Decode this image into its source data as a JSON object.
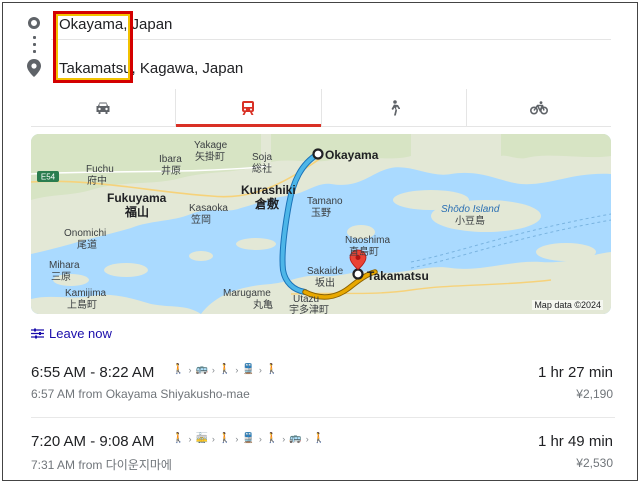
{
  "route": {
    "origin": "Okayama, Japan",
    "destination": "Takamatsu, Kagawa, Japan"
  },
  "modes": [
    {
      "name": "car-icon",
      "active": false
    },
    {
      "name": "train-icon",
      "active": true
    },
    {
      "name": "walk-icon",
      "active": false
    },
    {
      "name": "bike-icon",
      "active": false
    }
  ],
  "map": {
    "labels": {
      "okayama": "Okayama",
      "takamatsu": "Takamatsu",
      "kurashiki": "Kurashiki",
      "kurashiki_jp": "倉敷",
      "fukuyama": "Fukuyama",
      "fukuyama_jp": "福山",
      "yakage": "Yakage",
      "yakage_jp": "矢掛町",
      "soja": "Soja",
      "soja_jp": "総社",
      "ibara": "Ibara",
      "ibara_jp": "井原",
      "fuchu": "Fuchu",
      "fuchu_jp": "府中",
      "kasaoka": "Kasaoka",
      "kasaoka_jp": "笠岡",
      "tamano": "Tamano",
      "tamano_jp": "玉野",
      "onomichi": "Onomichi",
      "onomichi_jp": "尾道",
      "mihara": "Mihara",
      "mihara_jp": "三原",
      "kamijima": "Kamijima",
      "kamijima_jp": "上島町",
      "naoshima": "Naoshima",
      "naoshima_jp": "直島町",
      "shodo": "Shōdo Island",
      "shodo_jp": "小豆島",
      "sakaide": "Sakaide",
      "sakaide_jp": "坂出",
      "marugame": "Marugame",
      "marugame_jp": "丸亀",
      "utazu": "Utazu",
      "utazu_jp": "宇多津町",
      "highway": "E54"
    },
    "attribution": "Map data ©2024",
    "colors": {
      "route_main": "#4db6e8",
      "route_alt": "#e8a800",
      "water": "#aadaff",
      "land": "#e8eadc"
    }
  },
  "leave_now": "Leave now",
  "trips": [
    {
      "times": "6:55 AM - 8:22 AM",
      "depart": "6:57 AM from Okayama Shiyakusho-mae",
      "duration": "1 hr 27 min",
      "fare": "¥2,190",
      "steps": [
        "walk",
        "bus",
        "walk",
        "train",
        "walk"
      ]
    },
    {
      "times": "7:20 AM - 9:08 AM",
      "depart": "7:31 AM from 다이운지마에",
      "duration": "1 hr 49 min",
      "fare": "¥2,530",
      "steps": [
        "walk",
        "tram",
        "walk",
        "train",
        "walk",
        "bus",
        "walk"
      ]
    }
  ]
}
